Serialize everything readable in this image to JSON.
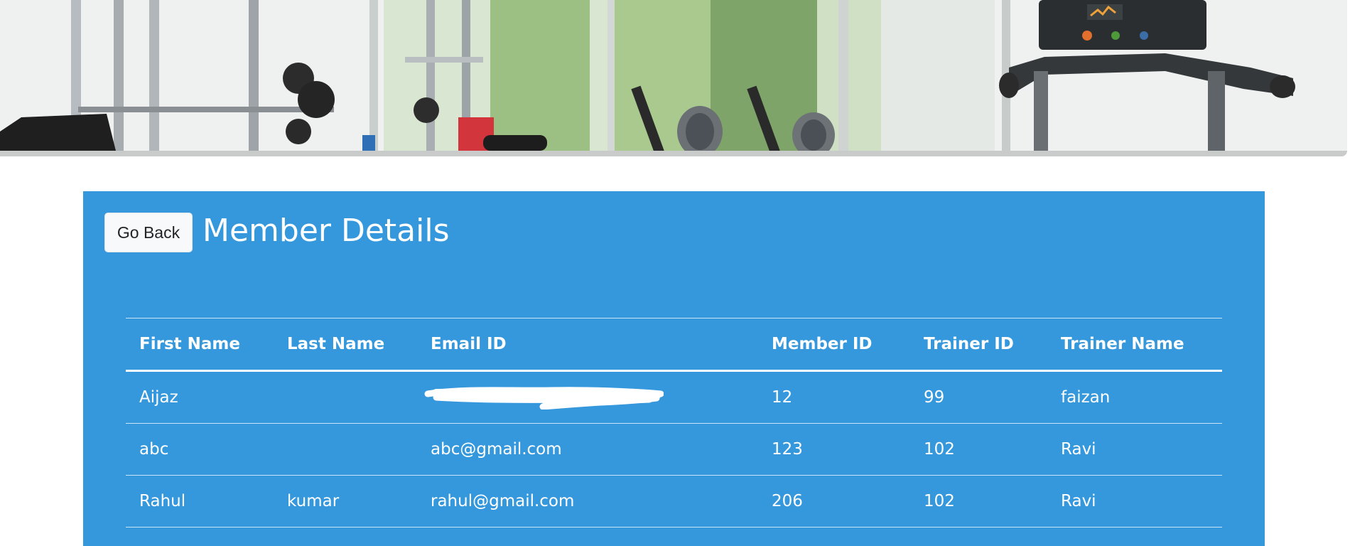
{
  "banner": {
    "image_description_icon": "gym-banner-image"
  },
  "page": {
    "back_label": "Go Back",
    "title": "Member Details"
  },
  "table": {
    "headers": [
      "First Name",
      "Last Name",
      "Email ID",
      "Member ID",
      "Trainer ID",
      "Trainer Name"
    ],
    "rows": [
      {
        "first_name": "Aijaz",
        "last_name": "",
        "email": "",
        "email_redacted": true,
        "member_id": "12",
        "trainer_id": "99",
        "trainer_name": "faizan"
      },
      {
        "first_name": "abc",
        "last_name": "",
        "email": "abc@gmail.com",
        "email_redacted": false,
        "member_id": "123",
        "trainer_id": "102",
        "trainer_name": "Ravi"
      },
      {
        "first_name": "Rahul",
        "last_name": "kumar",
        "email": "rahul@gmail.com",
        "email_redacted": false,
        "member_id": "206",
        "trainer_id": "102",
        "trainer_name": "Ravi"
      }
    ]
  },
  "colors": {
    "panel": "#3598dc",
    "text": "#ffffff",
    "button_bg": "#f8f9fa"
  }
}
